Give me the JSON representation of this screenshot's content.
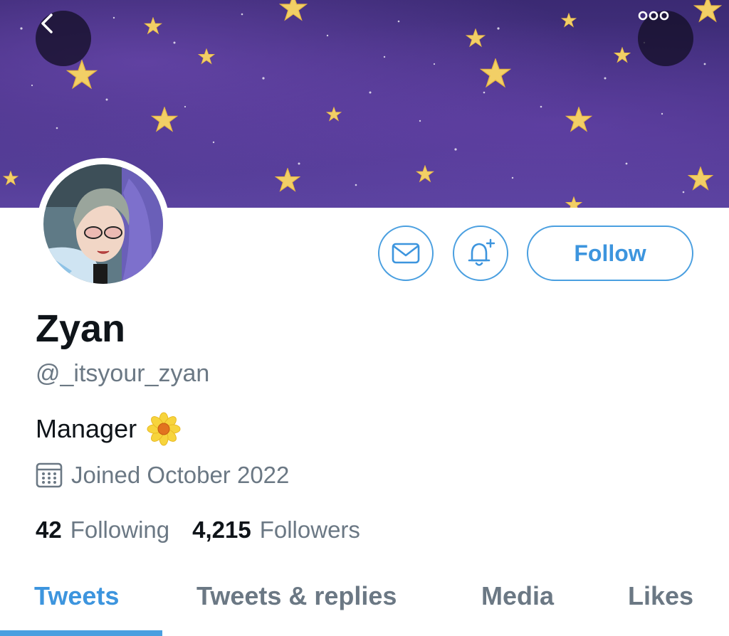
{
  "header": {
    "back_icon": "chevron-left-icon",
    "more_icon": "ellipsis-icon"
  },
  "profile": {
    "name": "Zyan",
    "handle": "@_itsyour_zyan",
    "bio": "Manager",
    "bio_emoji": "sunflower-emoji",
    "joined": "Joined October 2022",
    "following_count": "42",
    "following_label": "Following",
    "followers_count": "4,215",
    "followers_label": "Followers"
  },
  "actions": {
    "message_icon": "envelope-icon",
    "notify_icon": "bell-plus-icon",
    "follow_label": "Follow"
  },
  "tabs": [
    {
      "label": "Tweets",
      "active": true
    },
    {
      "label": "Tweets & replies",
      "active": false
    },
    {
      "label": "Media",
      "active": false
    },
    {
      "label": "Likes",
      "active": false
    }
  ],
  "colors": {
    "accent": "#4a9fe0",
    "banner": "#4a3589",
    "text_primary": "#0f1419",
    "text_secondary": "#6b7884"
  }
}
